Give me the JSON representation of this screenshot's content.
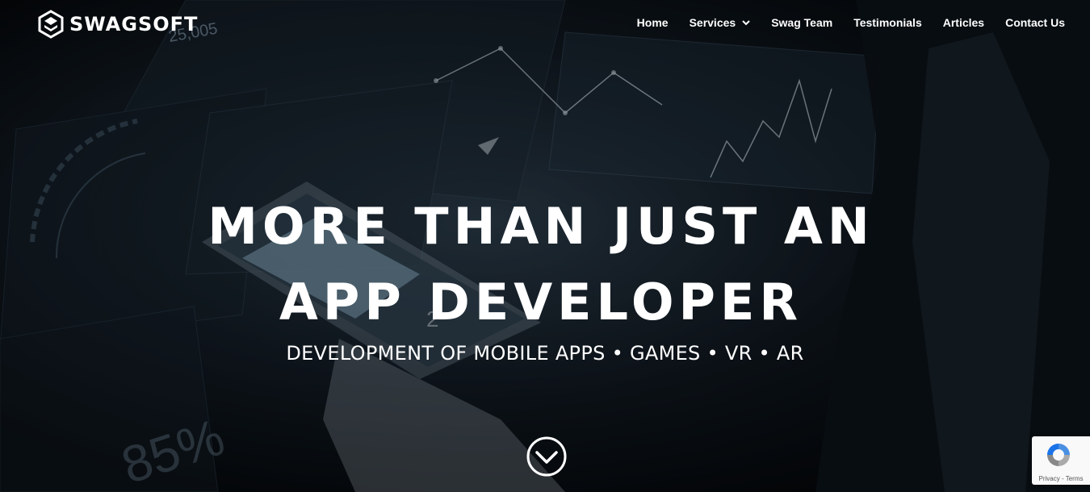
{
  "brand": {
    "name": "SWAGSOFT",
    "logo_icon": "hexagon-logo-icon"
  },
  "nav": {
    "items": [
      {
        "label": "Home"
      },
      {
        "label": "Services",
        "has_dropdown": true
      },
      {
        "label": "Swag Team"
      },
      {
        "label": "Testimonials"
      },
      {
        "label": "Articles"
      },
      {
        "label": "Contact Us"
      }
    ]
  },
  "hero": {
    "headline_line1": "MORE THAN JUST AN",
    "headline_line2": "APP DEVELOPER",
    "subheadline": "DEVELOPMENT OF MOBILE APPS • GAMES • VR • AR",
    "scroll_icon": "chevron-down-circle-icon"
  },
  "background_text": {
    "number": "25,005",
    "percent": "85%",
    "digit": "2"
  },
  "recaptcha": {
    "privacy_label": "Privacy",
    "separator": " - ",
    "terms_label": "Terms"
  },
  "colors": {
    "text": "#ffffff",
    "background": "#05080b",
    "accent": "#6e8fa8"
  }
}
